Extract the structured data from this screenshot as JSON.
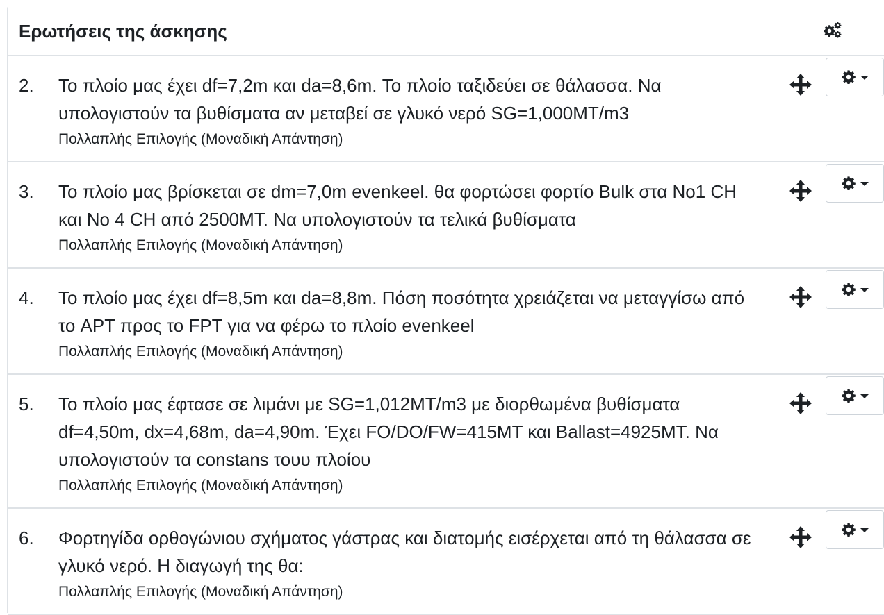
{
  "header": {
    "title": "Ερωτήσεις της άσκησης",
    "actions_icon": "gears-icon"
  },
  "questions": [
    {
      "number": "2.",
      "text": "Το πλοίο μας έχει df=7,2m και da=8,6m. Το πλοίο ταξιδεύει σε θάλασσα. Να υπολογιστούν τα βυθίσματα αν μεταβεί σε γλυκό νερό SG=1,000MT/m3",
      "type": "Πολλαπλής Επιλογής (Μοναδική Απάντηση)"
    },
    {
      "number": "3.",
      "text": "Το πλοίο μας βρίσκεται σε dm=7,0m evenkeel. θα φορτώσει φορτίο Bulk στα No1 CH και No 4 CH από 2500MT. Να υπολογιστούν τα τελικά βυθίσματα",
      "type": "Πολλαπλής Επιλογής (Μοναδική Απάντηση)"
    },
    {
      "number": "4.",
      "text": "Το πλοίο μας έχει df=8,5m και da=8,8m. Πόση ποσότητα χρειάζεται να μεταγγίσω από το APT προς το FPT για να φέρω το πλοίο evenkeel",
      "type": "Πολλαπλής Επιλογής (Μοναδική Απάντηση)"
    },
    {
      "number": "5.",
      "text": "Το πλοίο μας έφτασε σε λιμάνι με SG=1,012MT/m3 με διορθωμένα βυθίσματα df=4,50m, dx=4,68m, da=4,90m. Έχει FO/DO/FW=415MT και Ballast=4925MT. Να υπολογιστούν τα constans τουυ πλοίου",
      "type": "Πολλαπλής Επιλογής (Μοναδική Απάντηση)"
    },
    {
      "number": "6.",
      "text": "Φορτηγίδα ορθογώνιου σχήματος γάστρας και διατομής εισέρχεται από τη θάλασσα σε γλυκό νερό. Η διαγωγή της θα:",
      "type": "Πολλαπλής Επιλογής (Μοναδική Απάντηση)"
    }
  ],
  "row_actions": {
    "move_icon": "move-arrows-icon",
    "menu_icon": "cog-icon",
    "menu_caret_icon": "caret-down-icon"
  }
}
